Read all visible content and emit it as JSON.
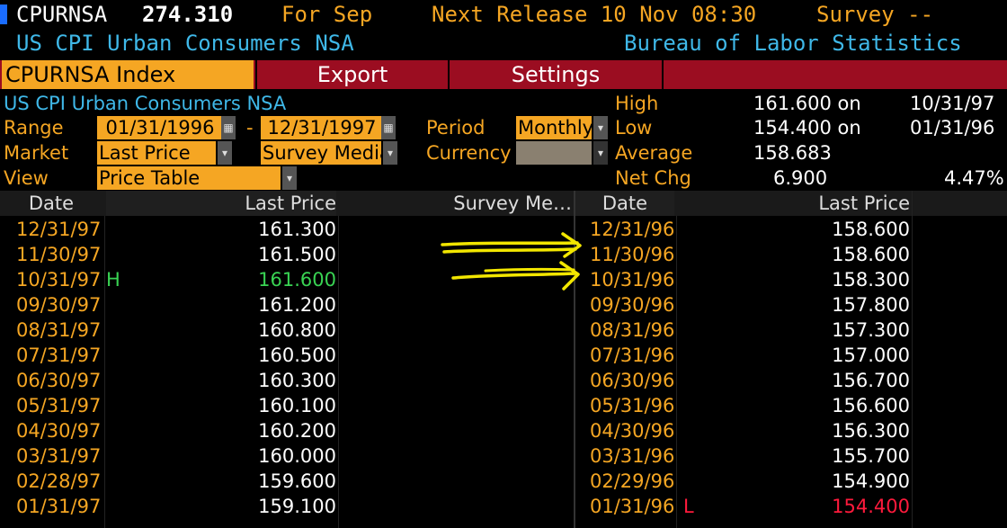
{
  "header": {
    "ticker": "CPURNSA",
    "value": "274.310",
    "for_label": "For Sep",
    "next_release": "Next Release 10 Nov 08:30",
    "survey": "Survey --",
    "description": "US CPI Urban Consumers NSA",
    "source": "Bureau of Labor Statistics"
  },
  "tabs": {
    "active": "CPURNSA Index",
    "export": "Export",
    "settings": "Settings"
  },
  "controls": {
    "description": "US CPI Urban Consumers NSA",
    "range_label": "Range",
    "range_start": "01/31/1996",
    "range_sep": "-",
    "range_end": "12/31/1997",
    "period_label": "Period",
    "period_value": "Monthly",
    "market_label": "Market",
    "market_value": "Last Price",
    "market_value2": "Survey Media",
    "currency_label": "Currency",
    "view_label": "View",
    "view_value": "Price Table"
  },
  "stats": {
    "high_label": "High",
    "high_value": "161.600 on",
    "high_date": "10/31/97",
    "low_label": "Low",
    "low_value": "154.400 on",
    "low_date": "01/31/96",
    "avg_label": "Average",
    "avg_value": "158.683",
    "netchg_label": "Net Chg",
    "netchg_value": "6.900",
    "netchg_pct": "4.47%"
  },
  "columns": {
    "date": "Date",
    "last_price": "Last Price",
    "survey": "Survey Me…",
    "date2": "Date",
    "last_price2": "Last Price"
  },
  "left_rows": [
    {
      "date": "12/31/97",
      "flag": "",
      "price": "161.300"
    },
    {
      "date": "11/30/97",
      "flag": "",
      "price": "161.500"
    },
    {
      "date": "10/31/97",
      "flag": "H",
      "price": "161.600"
    },
    {
      "date": "09/30/97",
      "flag": "",
      "price": "161.200"
    },
    {
      "date": "08/31/97",
      "flag": "",
      "price": "160.800"
    },
    {
      "date": "07/31/97",
      "flag": "",
      "price": "160.500"
    },
    {
      "date": "06/30/97",
      "flag": "",
      "price": "160.300"
    },
    {
      "date": "05/31/97",
      "flag": "",
      "price": "160.100"
    },
    {
      "date": "04/30/97",
      "flag": "",
      "price": "160.200"
    },
    {
      "date": "03/31/97",
      "flag": "",
      "price": "160.000"
    },
    {
      "date": "02/28/97",
      "flag": "",
      "price": "159.600"
    },
    {
      "date": "01/31/97",
      "flag": "",
      "price": "159.100"
    }
  ],
  "right_rows": [
    {
      "date": "12/31/96",
      "flag": "",
      "price": "158.600"
    },
    {
      "date": "11/30/96",
      "flag": "",
      "price": "158.600"
    },
    {
      "date": "10/31/96",
      "flag": "",
      "price": "158.300"
    },
    {
      "date": "09/30/96",
      "flag": "",
      "price": "157.800"
    },
    {
      "date": "08/31/96",
      "flag": "",
      "price": "157.300"
    },
    {
      "date": "07/31/96",
      "flag": "",
      "price": "157.000"
    },
    {
      "date": "06/30/96",
      "flag": "",
      "price": "156.700"
    },
    {
      "date": "05/31/96",
      "flag": "",
      "price": "156.600"
    },
    {
      "date": "04/30/96",
      "flag": "",
      "price": "156.300"
    },
    {
      "date": "03/31/96",
      "flag": "",
      "price": "155.700"
    },
    {
      "date": "02/29/96",
      "flag": "",
      "price": "154.900"
    },
    {
      "date": "01/31/96",
      "flag": "L",
      "price": "154.400"
    }
  ],
  "colors": {
    "amber": "#f5a623",
    "tab_red": "#9b0d21",
    "cyan": "#3fb8e8",
    "high_green": "#39d353",
    "low_red": "#ff1a3c",
    "annotation_yellow": "#f2e600"
  },
  "annotations": {
    "arrows": [
      "arrow-to-11/30/96",
      "arrow-to-10/31/96"
    ]
  }
}
